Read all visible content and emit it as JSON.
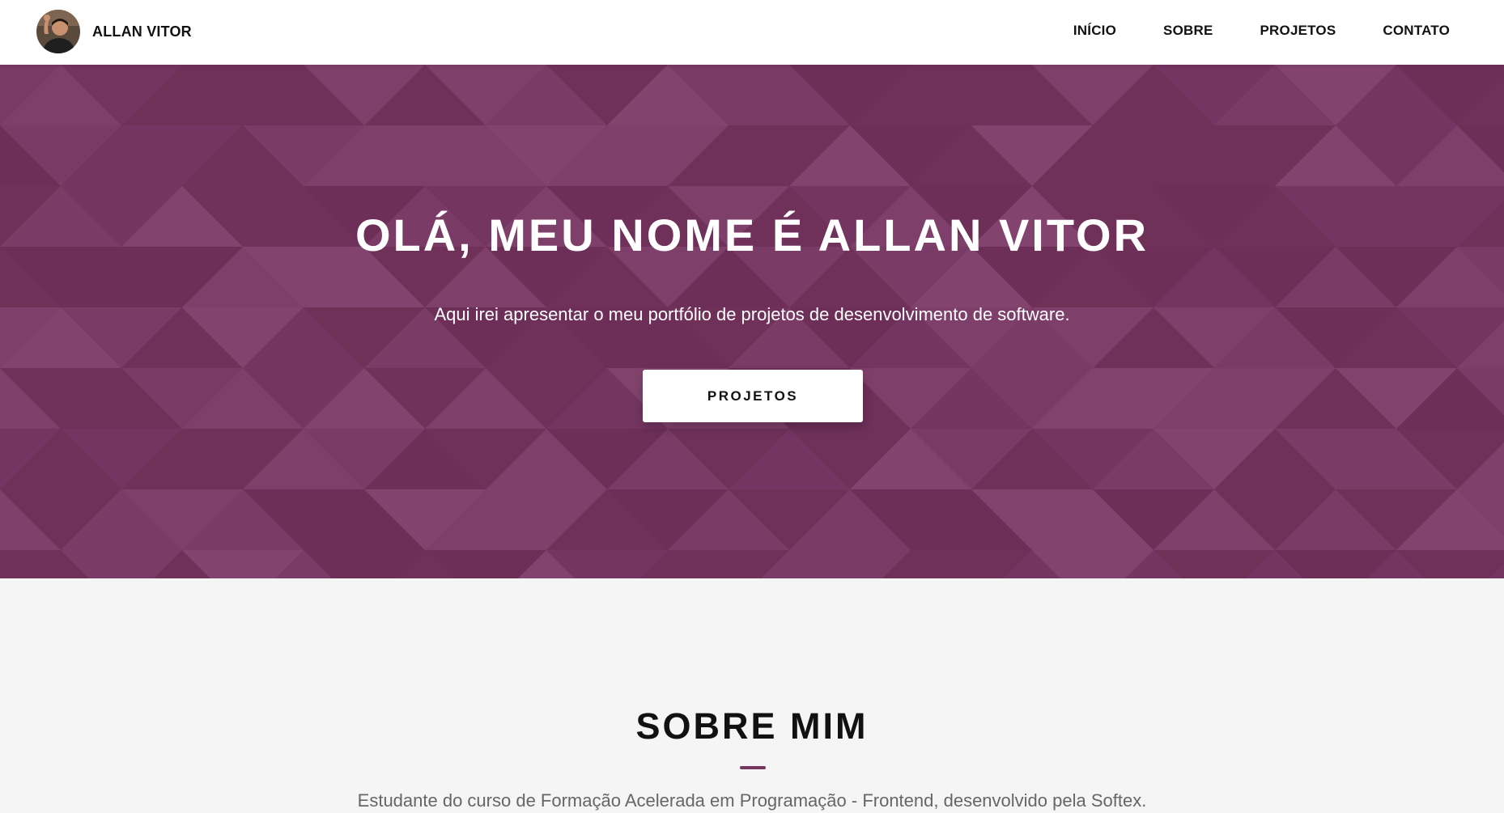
{
  "header": {
    "brand_name": "ALLAN VITOR",
    "avatar_icon": "profile-photo",
    "nav": [
      {
        "label": "INÍCIO"
      },
      {
        "label": "SOBRE"
      },
      {
        "label": "PROJETOS"
      },
      {
        "label": "CONTATO"
      }
    ]
  },
  "hero": {
    "title": "OLÁ, MEU NOME É ALLAN VITOR",
    "subtitle": "Aqui irei apresentar o meu portfólio de projetos de desenvolvimento de software.",
    "button_label": "PROJETOS",
    "background_color": "#753660"
  },
  "about": {
    "title": "SOBRE MIM",
    "text": "Estudante do curso de Formação Acelerada em Programação - Frontend, desenvolvido pela Softex.",
    "accent_color": "#753660"
  }
}
